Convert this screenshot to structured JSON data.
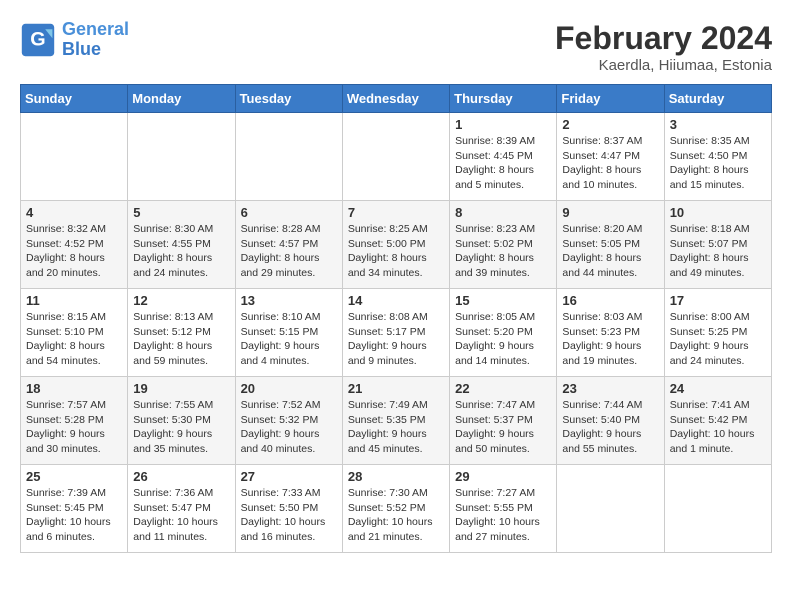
{
  "header": {
    "logo_line1": "General",
    "logo_line2": "Blue",
    "title": "February 2024",
    "location": "Kaerdla, Hiiumaa, Estonia"
  },
  "weekdays": [
    "Sunday",
    "Monday",
    "Tuesday",
    "Wednesday",
    "Thursday",
    "Friday",
    "Saturday"
  ],
  "weeks": [
    [
      {
        "day": "",
        "info": ""
      },
      {
        "day": "",
        "info": ""
      },
      {
        "day": "",
        "info": ""
      },
      {
        "day": "",
        "info": ""
      },
      {
        "day": "1",
        "info": "Sunrise: 8:39 AM\nSunset: 4:45 PM\nDaylight: 8 hours\nand 5 minutes."
      },
      {
        "day": "2",
        "info": "Sunrise: 8:37 AM\nSunset: 4:47 PM\nDaylight: 8 hours\nand 10 minutes."
      },
      {
        "day": "3",
        "info": "Sunrise: 8:35 AM\nSunset: 4:50 PM\nDaylight: 8 hours\nand 15 minutes."
      }
    ],
    [
      {
        "day": "4",
        "info": "Sunrise: 8:32 AM\nSunset: 4:52 PM\nDaylight: 8 hours\nand 20 minutes."
      },
      {
        "day": "5",
        "info": "Sunrise: 8:30 AM\nSunset: 4:55 PM\nDaylight: 8 hours\nand 24 minutes."
      },
      {
        "day": "6",
        "info": "Sunrise: 8:28 AM\nSunset: 4:57 PM\nDaylight: 8 hours\nand 29 minutes."
      },
      {
        "day": "7",
        "info": "Sunrise: 8:25 AM\nSunset: 5:00 PM\nDaylight: 8 hours\nand 34 minutes."
      },
      {
        "day": "8",
        "info": "Sunrise: 8:23 AM\nSunset: 5:02 PM\nDaylight: 8 hours\nand 39 minutes."
      },
      {
        "day": "9",
        "info": "Sunrise: 8:20 AM\nSunset: 5:05 PM\nDaylight: 8 hours\nand 44 minutes."
      },
      {
        "day": "10",
        "info": "Sunrise: 8:18 AM\nSunset: 5:07 PM\nDaylight: 8 hours\nand 49 minutes."
      }
    ],
    [
      {
        "day": "11",
        "info": "Sunrise: 8:15 AM\nSunset: 5:10 PM\nDaylight: 8 hours\nand 54 minutes."
      },
      {
        "day": "12",
        "info": "Sunrise: 8:13 AM\nSunset: 5:12 PM\nDaylight: 8 hours\nand 59 minutes."
      },
      {
        "day": "13",
        "info": "Sunrise: 8:10 AM\nSunset: 5:15 PM\nDaylight: 9 hours\nand 4 minutes."
      },
      {
        "day": "14",
        "info": "Sunrise: 8:08 AM\nSunset: 5:17 PM\nDaylight: 9 hours\nand 9 minutes."
      },
      {
        "day": "15",
        "info": "Sunrise: 8:05 AM\nSunset: 5:20 PM\nDaylight: 9 hours\nand 14 minutes."
      },
      {
        "day": "16",
        "info": "Sunrise: 8:03 AM\nSunset: 5:23 PM\nDaylight: 9 hours\nand 19 minutes."
      },
      {
        "day": "17",
        "info": "Sunrise: 8:00 AM\nSunset: 5:25 PM\nDaylight: 9 hours\nand 24 minutes."
      }
    ],
    [
      {
        "day": "18",
        "info": "Sunrise: 7:57 AM\nSunset: 5:28 PM\nDaylight: 9 hours\nand 30 minutes."
      },
      {
        "day": "19",
        "info": "Sunrise: 7:55 AM\nSunset: 5:30 PM\nDaylight: 9 hours\nand 35 minutes."
      },
      {
        "day": "20",
        "info": "Sunrise: 7:52 AM\nSunset: 5:32 PM\nDaylight: 9 hours\nand 40 minutes."
      },
      {
        "day": "21",
        "info": "Sunrise: 7:49 AM\nSunset: 5:35 PM\nDaylight: 9 hours\nand 45 minutes."
      },
      {
        "day": "22",
        "info": "Sunrise: 7:47 AM\nSunset: 5:37 PM\nDaylight: 9 hours\nand 50 minutes."
      },
      {
        "day": "23",
        "info": "Sunrise: 7:44 AM\nSunset: 5:40 PM\nDaylight: 9 hours\nand 55 minutes."
      },
      {
        "day": "24",
        "info": "Sunrise: 7:41 AM\nSunset: 5:42 PM\nDaylight: 10 hours\nand 1 minute."
      }
    ],
    [
      {
        "day": "25",
        "info": "Sunrise: 7:39 AM\nSunset: 5:45 PM\nDaylight: 10 hours\nand 6 minutes."
      },
      {
        "day": "26",
        "info": "Sunrise: 7:36 AM\nSunset: 5:47 PM\nDaylight: 10 hours\nand 11 minutes."
      },
      {
        "day": "27",
        "info": "Sunrise: 7:33 AM\nSunset: 5:50 PM\nDaylight: 10 hours\nand 16 minutes."
      },
      {
        "day": "28",
        "info": "Sunrise: 7:30 AM\nSunset: 5:52 PM\nDaylight: 10 hours\nand 21 minutes."
      },
      {
        "day": "29",
        "info": "Sunrise: 7:27 AM\nSunset: 5:55 PM\nDaylight: 10 hours\nand 27 minutes."
      },
      {
        "day": "",
        "info": ""
      },
      {
        "day": "",
        "info": ""
      }
    ]
  ]
}
